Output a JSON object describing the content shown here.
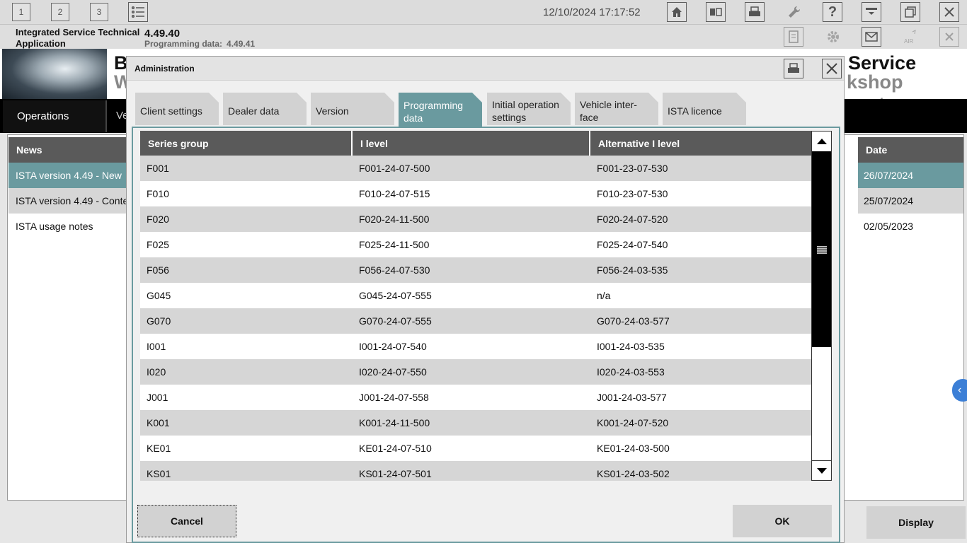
{
  "topbar": {
    "screen_tabs": [
      "1",
      "2",
      "3"
    ],
    "datetime": "12/10/2024 17:17:52",
    "icons": [
      "list-icon",
      "home-icon",
      "dual-screen-icon",
      "print-icon",
      "wrench-icon",
      "help-icon",
      "minimize-icon",
      "restore-icon",
      "close-icon"
    ]
  },
  "appbar": {
    "title": "Integrated Service Technical Application",
    "version": "4.49.40",
    "programming_label": "Programming data:",
    "programming_version": "4.49.41"
  },
  "background": {
    "banner_left_1": "B",
    "banner_left_2": "W",
    "banner_right_1": "Service",
    "banner_right_2": "kshop system",
    "nav_operations": "Operations",
    "nav_second": "Ve",
    "news_header": "News",
    "date_header": "Date",
    "news_rows": [
      {
        "title": "ISTA version 4.49 - New",
        "date": "26/07/2024"
      },
      {
        "title": "ISTA version 4.49 - Conte",
        "date": "25/07/2024"
      },
      {
        "title": "ISTA usage notes",
        "date": "02/05/2023"
      }
    ],
    "display_label": "Display"
  },
  "dialog": {
    "title": "Administration",
    "tabs": [
      {
        "line1": "Client settings",
        "line2": ""
      },
      {
        "line1": "Dealer data",
        "line2": ""
      },
      {
        "line1": "Version",
        "line2": ""
      },
      {
        "line1": "Programming",
        "line2": "data"
      },
      {
        "line1": "Initial operation",
        "line2": "settings"
      },
      {
        "line1": "Vehicle inter-",
        "line2": "face"
      },
      {
        "line1": "ISTA licence",
        "line2": ""
      }
    ],
    "active_tab": "Programming data",
    "columns": [
      "Series group",
      "I level",
      "Alternative I level"
    ],
    "rows": [
      [
        "F001",
        "F001-24-07-500",
        "F001-23-07-530"
      ],
      [
        "F010",
        "F010-24-07-515",
        "F010-23-07-530"
      ],
      [
        "F020",
        "F020-24-11-500",
        "F020-24-07-520"
      ],
      [
        "F025",
        "F025-24-11-500",
        "F025-24-07-540"
      ],
      [
        "F056",
        "F056-24-07-530",
        "F056-24-03-535"
      ],
      [
        "G045",
        "G045-24-07-555",
        "n/a"
      ],
      [
        "G070",
        "G070-24-07-555",
        "G070-24-03-577"
      ],
      [
        "I001",
        "I001-24-07-540",
        "I001-24-03-535"
      ],
      [
        "I020",
        "I020-24-07-550",
        "I020-24-03-553"
      ],
      [
        "J001",
        "J001-24-07-558",
        "J001-24-03-577"
      ],
      [
        "K001",
        "K001-24-11-500",
        "K001-24-07-520"
      ],
      [
        "KE01",
        "KE01-24-07-510",
        "KE01-24-03-500"
      ],
      [
        "KS01",
        "KS01-24-07-501",
        "KS01-24-03-502"
      ]
    ],
    "cancel_label": "Cancel",
    "ok_label": "OK"
  },
  "colors": {
    "accent_teal": "#6a9a9f",
    "header_gray": "#5a5a5a",
    "row_alt": "#d6d6d6"
  }
}
